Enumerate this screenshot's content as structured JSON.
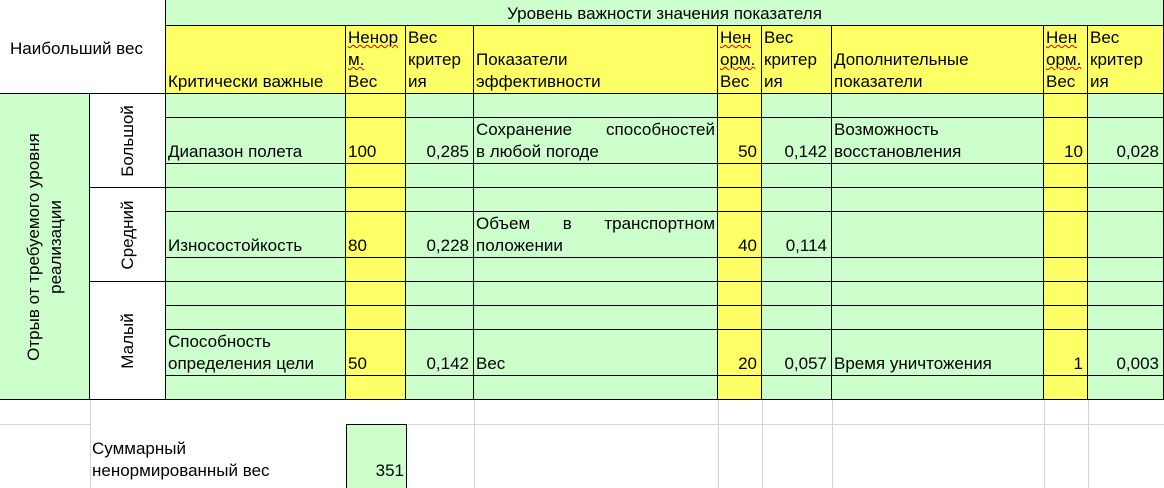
{
  "header": {
    "top_title": "Уровень важности значения показателя",
    "max_weight": "Наибольший вес",
    "critical": "Критически важные",
    "unnorm_weight_a": "Ненор",
    "unnorm_weight_b": "м.",
    "unnorm_weight_c": "Вес",
    "crit_weight_a": "Вес",
    "crit_weight_b": "критер",
    "crit_weight_c": "ия",
    "efficiency_a": "Показатели",
    "efficiency_b": "эффективности",
    "unnorm2_a": "Нен",
    "unnorm2_b": "орм.",
    "unnorm2_c": "Вес",
    "additional_a": "Дополнительные",
    "additional_b": "показатели"
  },
  "side": {
    "gap_label_a": "Отрыв от требуемого уровня",
    "gap_label_b": "реализации",
    "big": "Большой",
    "medium": "Средний",
    "small": "Малый"
  },
  "rows": {
    "big": {
      "crit_name": "Диапазон полета",
      "crit_unnorm": "100",
      "crit_weight": "0,285",
      "eff_name_a": "Сохранение способностей",
      "eff_name_b": "в любой погоде",
      "eff_unnorm": "50",
      "eff_weight": "0,142",
      "add_name_a": "Возможность",
      "add_name_b": "восстановления",
      "add_unnorm": "10",
      "add_weight": "0,028"
    },
    "medium": {
      "crit_name": "Износостойкость",
      "crit_unnorm": "80",
      "crit_weight": "0,228",
      "eff_name_a": "Объем в транспортном",
      "eff_name_b": "положении",
      "eff_unnorm": "40",
      "eff_weight": "0,114"
    },
    "small": {
      "crit_name_a": "Способность",
      "crit_name_b": "определения цели",
      "crit_unnorm": "50",
      "crit_weight": "0,142",
      "eff_name": "Вес",
      "eff_unnorm": "20",
      "eff_weight": "0,057",
      "add_name": "Время уничтожения",
      "add_unnorm": "1",
      "add_weight": "0,003"
    }
  },
  "summary": {
    "label_a": "Суммарный",
    "label_b": "ненормированный вес",
    "value": "351"
  },
  "colors": {
    "green": "#ccffcc",
    "yellow": "#ffff66",
    "border": "#000000",
    "gridline": "#d4d4d4"
  }
}
